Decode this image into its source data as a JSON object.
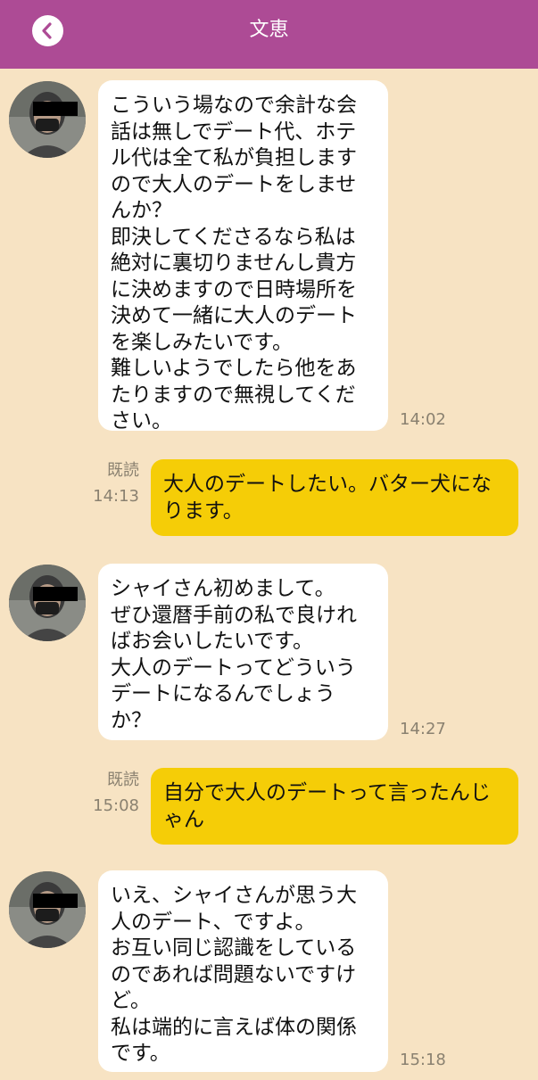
{
  "header": {
    "title": "文恵"
  },
  "messages": [
    {
      "text": "こういう場なので余計な会\n話は無しでデート代、ホテ\nル代は全て私が負担します\nので大人のデートをしませ\nんか？\n即決してくださるなら私は\n絶対に裏切りませんし貴方\nに決めますので日時場所を\n決めて一緒に大人のデート\nを楽しみたいです。\n難しいようでしたら他をあ\nたりますので無視してくだ\nさい。",
      "time": "14:02"
    },
    {
      "text": "大人のデートしたい。バター犬にな\nります。",
      "read": "既読",
      "time": "14:13"
    },
    {
      "text": "シャイさん初めまして。\nぜひ還暦手前の私で良けれ\nばお会いしたいです。\n大人のデートってどういう\nデートになるんでしょう\nか？",
      "time": "14:27"
    },
    {
      "text": "自分で大人のデートって言ったんじ\nゃん",
      "read": "既読",
      "time": "15:08"
    },
    {
      "text": "いえ、シャイさんが思う大\n人のデート、ですよ。\nお互い同じ認識をしている\nのであれば問題ないですけ\nど。\n私は端的に言えば体の関係\nです。",
      "time": "15:18"
    }
  ],
  "colors": {
    "header": "#ad4b95",
    "background": "#f7e3c3",
    "incoming_bubble": "#ffffff",
    "outgoing_bubble": "#f5cd07"
  },
  "icons": {
    "back": "chevron-left-icon",
    "avatar": "user-avatar"
  }
}
